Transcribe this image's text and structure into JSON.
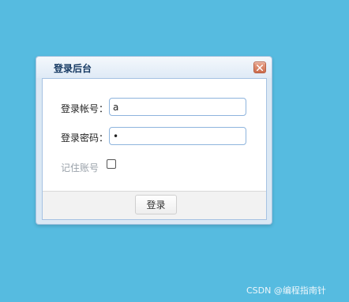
{
  "dialog": {
    "title": "登录后台",
    "close_icon": "close-icon"
  },
  "form": {
    "username_label": "登录帐号：",
    "username_value": "a",
    "password_label": "登录密码：",
    "password_value": "•",
    "remember_label": "记住账号",
    "remember_checked": false
  },
  "footer": {
    "login_button": "登录"
  },
  "watermark": "CSDN @编程指南针",
  "colors": {
    "background": "#56bbe0",
    "title_text": "#173a63",
    "close_button": "#cc6b4b"
  }
}
